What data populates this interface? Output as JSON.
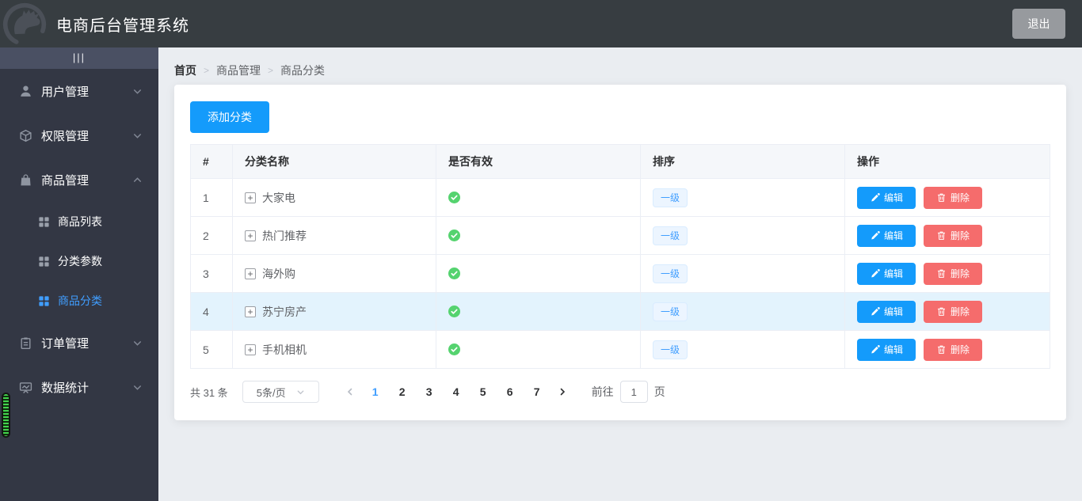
{
  "header": {
    "title": "电商后台管理系统",
    "logout_label": "退出",
    "logo_icon": "dark-horse-logo-icon"
  },
  "sidebar": {
    "toggle_label": "|||",
    "items": [
      {
        "label": "用户管理",
        "icon": "user-icon",
        "expanded": false
      },
      {
        "label": "权限管理",
        "icon": "cube-icon",
        "expanded": false
      },
      {
        "label": "商品管理",
        "icon": "shopping-bag-icon",
        "expanded": true,
        "children": [
          {
            "label": "商品列表",
            "icon": "grid-icon",
            "active": false
          },
          {
            "label": "分类参数",
            "icon": "grid-icon",
            "active": false
          },
          {
            "label": "商品分类",
            "icon": "grid-icon",
            "active": true
          }
        ]
      },
      {
        "label": "订单管理",
        "icon": "clipboard-icon",
        "expanded": false
      },
      {
        "label": "数据统计",
        "icon": "chart-board-icon",
        "expanded": false
      }
    ]
  },
  "breadcrumb": {
    "items": [
      "首页",
      "商品管理",
      "商品分类"
    ],
    "separator": ">"
  },
  "main": {
    "add_button_label": "添加分类",
    "table": {
      "columns": [
        "#",
        "分类名称",
        "是否有效",
        "排序",
        "操作"
      ],
      "expand_icon": "plus-expand-icon",
      "valid_icon": "check-circle-icon",
      "edit_label": "编辑",
      "delete_label": "删除",
      "rows": [
        {
          "index": "1",
          "name": "大家电",
          "valid": true,
          "level": "一级",
          "highlighted": false
        },
        {
          "index": "2",
          "name": "热门推荐",
          "valid": true,
          "level": "一级",
          "highlighted": false
        },
        {
          "index": "3",
          "name": "海外购",
          "valid": true,
          "level": "一级",
          "highlighted": false
        },
        {
          "index": "4",
          "name": "苏宁房产",
          "valid": true,
          "level": "一级",
          "highlighted": true
        },
        {
          "index": "5",
          "name": "手机相机",
          "valid": true,
          "level": "一级",
          "highlighted": false
        }
      ]
    },
    "pagination": {
      "total": "共 31 条",
      "page_size": "5条/页",
      "pages": [
        "1",
        "2",
        "3",
        "4",
        "5",
        "6",
        "7"
      ],
      "active_page": "1",
      "goto_label": "前往",
      "goto_value": "1",
      "goto_unit": "页"
    }
  },
  "colors": {
    "header_bg": "#373d41",
    "sidebar_bg": "#333744",
    "toggle_bg": "#4a5063",
    "content_bg": "#eaedf1",
    "primary_button": "#149bfb",
    "link_blue": "#409eff",
    "danger_red": "#f56c6c",
    "success_green": "#55d36f",
    "row_highlight": "#e3f3fd"
  }
}
